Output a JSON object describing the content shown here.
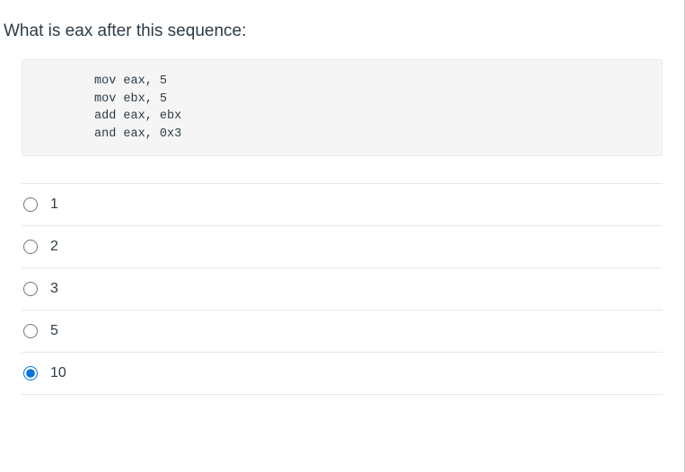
{
  "question": {
    "prompt": "What is eax after this sequence:",
    "code": "mov eax, 5\nmov ebx, 5\nadd eax, ebx\nand eax, 0x3"
  },
  "options": [
    {
      "label": "1",
      "selected": false
    },
    {
      "label": "2",
      "selected": false
    },
    {
      "label": "3",
      "selected": false
    },
    {
      "label": "5",
      "selected": false
    },
    {
      "label": "10",
      "selected": true
    }
  ]
}
